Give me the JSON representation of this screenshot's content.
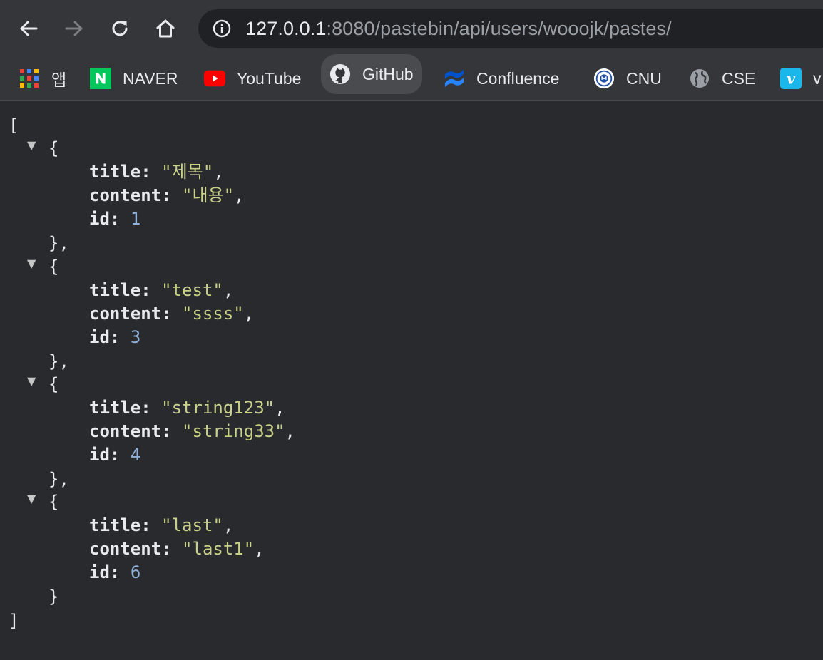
{
  "browser": {
    "url_host": "127.0.0.1",
    "url_rest": ":8080/pastebin/api/users/wooojk/pastes/",
    "bookmarks": [
      {
        "label": "앱",
        "icon": "apps-grid-icon"
      },
      {
        "label": "NAVER",
        "icon": "naver-icon",
        "color": "#03c75a"
      },
      {
        "label": "YouTube",
        "icon": "youtube-icon",
        "color": "#ff0000"
      },
      {
        "label": "GitHub",
        "icon": "github-icon"
      },
      {
        "label": "Confluence",
        "icon": "confluence-icon",
        "color": "#2684ff"
      },
      {
        "label": "CNU",
        "icon": "cnu-icon"
      },
      {
        "label": "CSE",
        "icon": "globe-icon"
      },
      {
        "label": "v",
        "icon": "vimeo-icon",
        "color": "#1ab7ea"
      }
    ]
  },
  "json_view": {
    "open_bracket": "[",
    "close_bracket": "]",
    "items": [
      {
        "title": "\"제목\"",
        "content": "\"내용\"",
        "id": "1"
      },
      {
        "title": "\"test\"",
        "content": "\"ssss\"",
        "id": "3"
      },
      {
        "title": "\"string123\"",
        "content": "\"string33\"",
        "id": "4"
      },
      {
        "title": "\"last\"",
        "content": "\"last1\"",
        "id": "6"
      }
    ],
    "key_title": "title:",
    "key_content": "content:",
    "key_id": "id:",
    "toggle_glyph": "▼",
    "open_brace": "{",
    "close_brace_comma": "},",
    "close_brace": "}",
    "comma": ","
  }
}
